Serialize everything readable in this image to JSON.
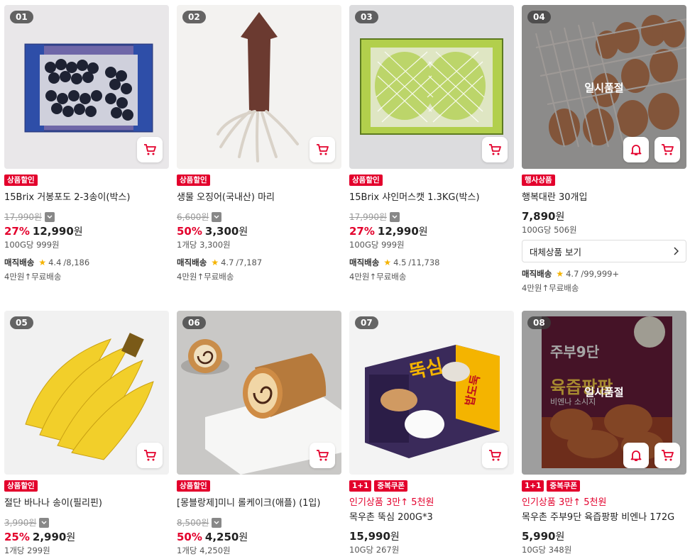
{
  "products": [
    {
      "rank": "01",
      "badges": [
        "상품할인"
      ],
      "name": "15Brix 거봉포도 2-3송이(박스)",
      "original_price": "17,990원",
      "discount": "27%",
      "price": "12,990",
      "won": "원",
      "unit_price": "100G당 999원",
      "delivery": "매직배송",
      "rating": "4.4",
      "reviews": "/8,186",
      "shipping": "4만원↑무료배송"
    },
    {
      "rank": "02",
      "badges": [
        "상품할인"
      ],
      "name": "생물 오징어(국내산) 마리",
      "original_price": "6,600원",
      "discount": "50%",
      "price": "3,300",
      "won": "원",
      "unit_price": "1개당 3,300원",
      "delivery": "매직배송",
      "rating": "4.7",
      "reviews": "/7,187",
      "shipping": "4만원↑무료배송"
    },
    {
      "rank": "03",
      "badges": [
        "상품할인"
      ],
      "name": "15Brix 샤인머스캣 1.3KG(박스)",
      "original_price": "17,990원",
      "discount": "27%",
      "price": "12,990",
      "won": "원",
      "unit_price": "100G당 999원",
      "delivery": "매직배송",
      "rating": "4.5",
      "reviews": "/11,738",
      "shipping": "4만원↑무료배송"
    },
    {
      "rank": "04",
      "badges": [
        "행사상품"
      ],
      "name": "행복대란 30개입",
      "price": "7,890",
      "won": "원",
      "unit_price": "100G당 506원",
      "soldout": "일시품절",
      "set_button": "대체상품 보기",
      "delivery": "매직배송",
      "rating": "4.7",
      "reviews": "/99,999+",
      "shipping": "4만원↑무료배송"
    },
    {
      "rank": "05",
      "badges": [
        "상품할인"
      ],
      "name": "절단 바나나 송이(필리핀)",
      "original_price": "3,990원",
      "discount": "25%",
      "price": "2,990",
      "won": "원",
      "unit_price": "1개당 299원"
    },
    {
      "rank": "06",
      "badges": [
        "상품할인"
      ],
      "name": "[몽블랑제]미니 롤케이크(애플) (1입)",
      "original_price": "8,500원",
      "discount": "50%",
      "price": "4,250",
      "won": "원",
      "unit_price": "1개당 4,250원"
    },
    {
      "rank": "07",
      "badges": [
        "1+1",
        "중복쿠폰"
      ],
      "promo": "인기상품 3만↑ 5천원",
      "name": "목우촌 뚝심 200G*3",
      "price": "15,990",
      "won": "원",
      "unit_price": "10G당 267원"
    },
    {
      "rank": "08",
      "badges": [
        "1+1",
        "중복쿠폰"
      ],
      "promo": "인기상품 3만↑ 5천원",
      "name": "목우촌 주부9단 육즙팡팡 비엔나 172G",
      "price": "5,990",
      "won": "원",
      "unit_price": "10G당 348원",
      "soldout": "일시품절"
    }
  ],
  "image_text": {
    "p07_brand": "뚝심",
    "p07_side": "밥도둑",
    "p08_brand": "주부9단",
    "p08_title": "육즙팡팡",
    "p08_sub": "비엔나 소시지"
  },
  "colors": {
    "accent": "#e3002c",
    "star": "#f5b301"
  }
}
